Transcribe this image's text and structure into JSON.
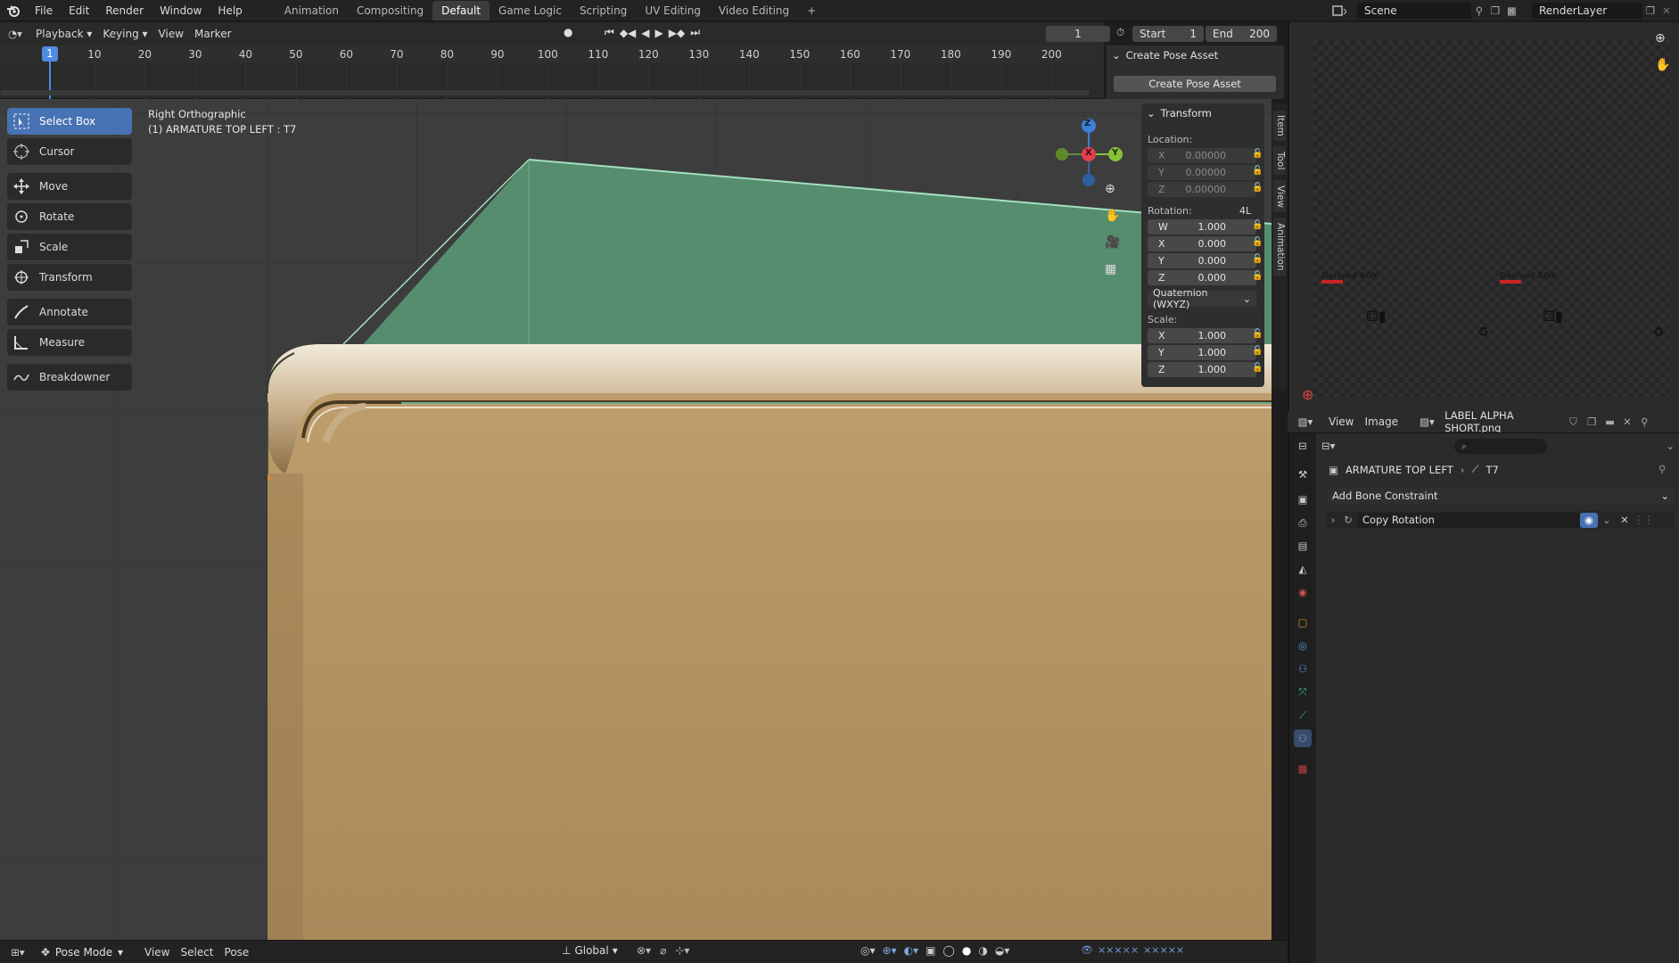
{
  "topbar": {
    "menus": [
      "File",
      "Edit",
      "Render",
      "Window",
      "Help"
    ],
    "workspaces": [
      "Animation",
      "Compositing",
      "Default",
      "Game Logic",
      "Scripting",
      "UV Editing",
      "Video Editing"
    ],
    "active_workspace": "Default",
    "add_tab": "+",
    "scene": "Scene",
    "view_layer": "RenderLayer"
  },
  "timeline": {
    "menus": [
      "Playback",
      "Keying",
      "View",
      "Marker"
    ],
    "current_frame": "1",
    "start_label": "Start",
    "start_value": "1",
    "end_label": "End",
    "end_value": "200",
    "ticks": [
      "10",
      "20",
      "30",
      "40",
      "50",
      "60",
      "70",
      "80",
      "90",
      "100",
      "110",
      "120",
      "130",
      "140",
      "150",
      "160",
      "170",
      "180",
      "190",
      "200"
    ],
    "playhead": "1"
  },
  "pose_panel": {
    "title": "Create Pose Asset",
    "button": "Create Pose Asset"
  },
  "viewport": {
    "view_name": "Right Orthographic",
    "object_info": "(1) ARMATURE TOP LEFT : T7",
    "tools": [
      "Select Box",
      "Cursor",
      "Move",
      "Rotate",
      "Scale",
      "Transform",
      "Annotate",
      "Measure",
      "Breakdowner"
    ],
    "gizmo": {
      "z": "Z",
      "x": "X",
      "y": "Y"
    },
    "side_tabs": [
      "Item",
      "Tool",
      "View",
      "Animation"
    ]
  },
  "transform": {
    "title": "Transform",
    "location_label": "Location:",
    "location": [
      {
        "axis": "X",
        "value": "0.00000"
      },
      {
        "axis": "Y",
        "value": "0.00000"
      },
      {
        "axis": "Z",
        "value": "0.00000"
      }
    ],
    "rotation_label": "Rotation:",
    "rotation_mode_short": "4L",
    "rotation": [
      {
        "axis": "W",
        "value": "1.000"
      },
      {
        "axis": "X",
        "value": "0.000"
      },
      {
        "axis": "Y",
        "value": "0.000"
      },
      {
        "axis": "Z",
        "value": "0.000"
      }
    ],
    "rotation_mode": "Quaternion (WXYZ)",
    "scale_label": "Scale:",
    "scale": [
      {
        "axis": "X",
        "value": "1.000"
      },
      {
        "axis": "Y",
        "value": "1.000"
      },
      {
        "axis": "Z",
        "value": "1.000"
      }
    ]
  },
  "bottombar": {
    "mode": "Pose Mode",
    "menus": [
      "View",
      "Select",
      "Pose"
    ],
    "orientation": "Global"
  },
  "image_editor": {
    "menus": [
      "View",
      "Image"
    ],
    "image_name": "LABEL ALPHA SHORT.png",
    "label_left": "Derived BOX",
    "label_right": "Derived BOX"
  },
  "properties": {
    "breadcrumb_object": "ARMATURE TOP LEFT",
    "breadcrumb_bone": "T7",
    "add_constraint": "Add Bone Constraint",
    "constraint_name": "Copy Rotation"
  },
  "colors": {
    "accent": "#4772b3",
    "green_shape": "#5a9b78",
    "tan_shape": "#b49466",
    "gizmo_x": "#e2404f",
    "gizmo_y": "#86c13a",
    "gizmo_z": "#3d7ed6"
  }
}
